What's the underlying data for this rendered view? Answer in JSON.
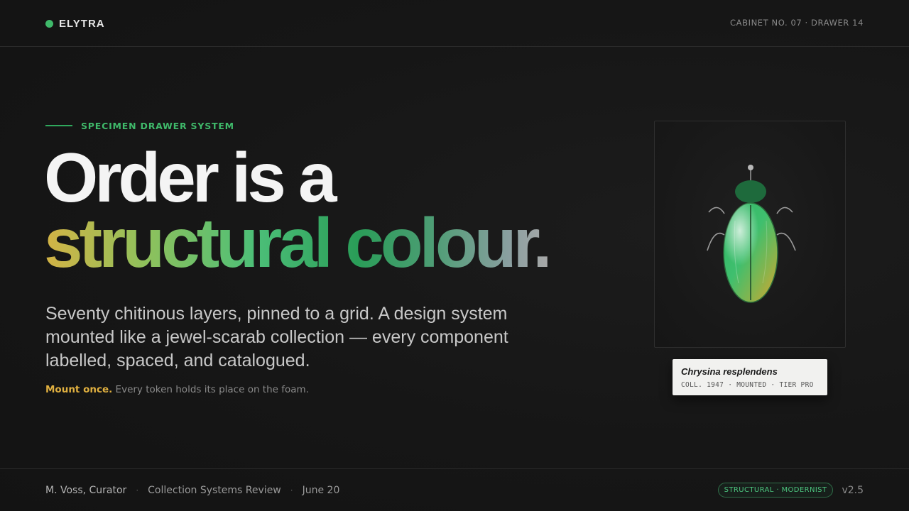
{
  "header": {
    "brand": "ELYTRA",
    "cabinet": "CABINET NO. 07 · DRAWER 14"
  },
  "hero": {
    "eyebrow": "SPECIMEN DRAWER SYSTEM",
    "headline_line1": "Order is a",
    "headline_line2": "structural colour.",
    "lede": "Seventy chitinous layers, pinned to a grid. A design system mounted like a jewel-scarab collection — every component labelled, spaced, and catalogued.",
    "note_emphasis": "Mount once.",
    "note_text": " Every token holds its place on the foam."
  },
  "specimen": {
    "icon": "beetle-icon",
    "label_name": "Chrysina resplendens",
    "label_meta": "COLL. 1947 · MOUNTED · TIER PRO"
  },
  "footer": {
    "curator": "M. Voss, Curator",
    "sep": "·",
    "review": "Collection Systems Review",
    "date": "June 20",
    "badge": "STRUCTURAL · MODERNIST",
    "version": "v2.5"
  },
  "colors": {
    "accent": "#3fb96a",
    "gold": "#e0b040",
    "background": "#161616"
  }
}
